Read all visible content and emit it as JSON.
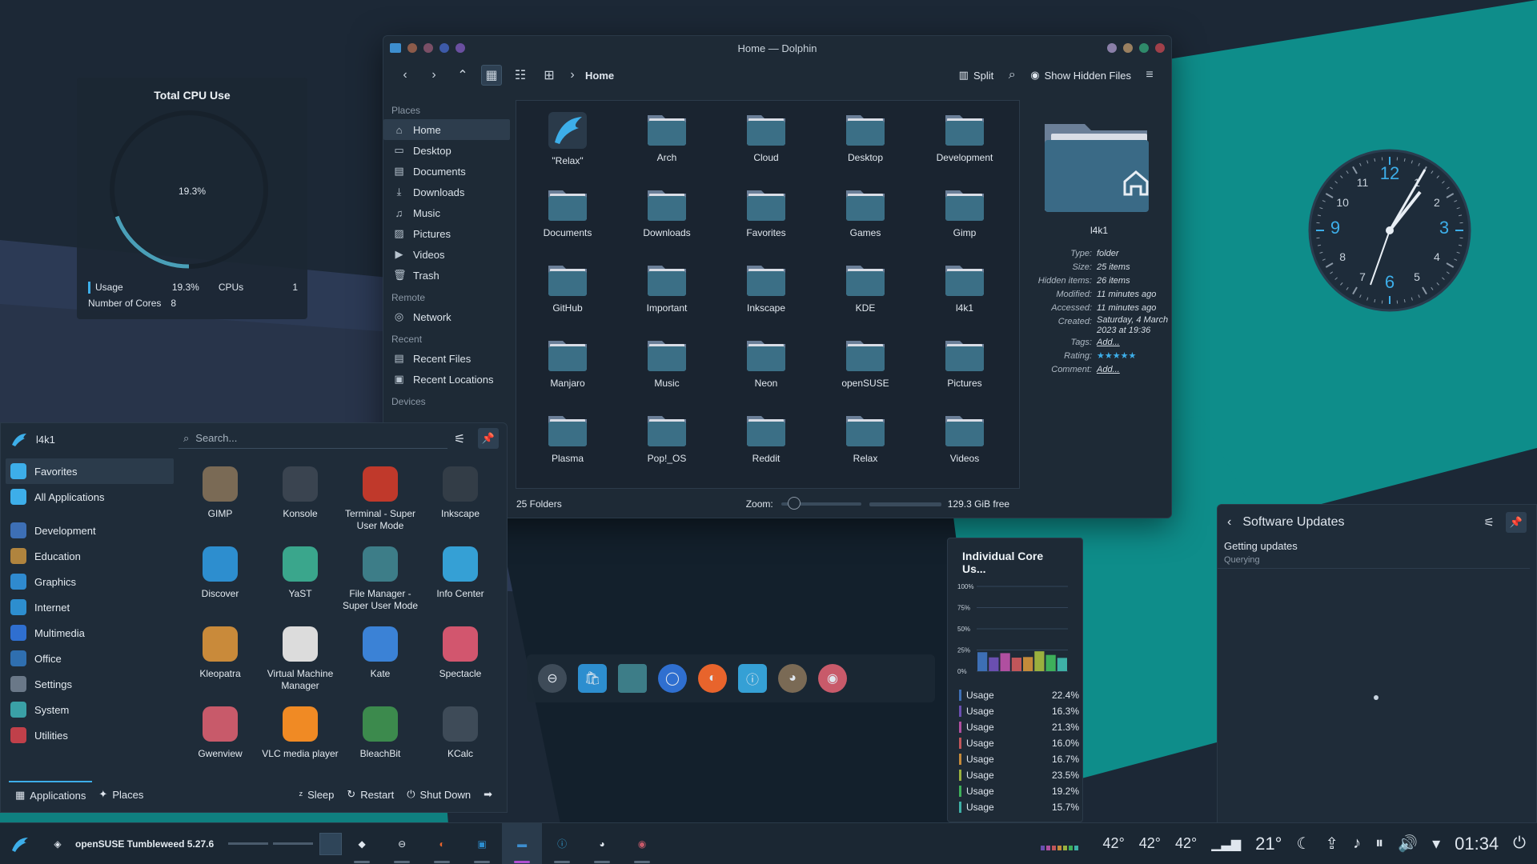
{
  "cpu_widget": {
    "title": "Total CPU Use",
    "percent": "19.3%",
    "usage_label": "Usage",
    "usage_value": "19.3%",
    "cpus_label": "CPUs",
    "cpus_value": "1",
    "cores_label": "Number of Cores",
    "cores_value": "8",
    "usage_fraction": 0.193
  },
  "dolphin": {
    "title": "Home — Dolphin",
    "breadcrumb": "Home",
    "split_label": "Split",
    "show_hidden_label": "Show Hidden Files",
    "places_section": "Places",
    "places": [
      "Home",
      "Desktop",
      "Documents",
      "Downloads",
      "Music",
      "Pictures",
      "Videos",
      "Trash"
    ],
    "remote_section": "Remote",
    "remote": [
      "Network"
    ],
    "recent_section": "Recent",
    "recent": [
      "Recent Files",
      "Recent Locations"
    ],
    "devices_section": "Devices",
    "folders": [
      "\"Relax\"",
      "Arch",
      "Cloud",
      "Desktop",
      "Development",
      "Documents",
      "Downloads",
      "Favorites",
      "Games",
      "Gimp",
      "GitHub",
      "Important",
      "Inkscape",
      "KDE",
      "l4k1",
      "Manjaro",
      "Music",
      "Neon",
      "openSUSE",
      "Pictures",
      "Plasma",
      "Pop!_OS",
      "Reddit",
      "Relax",
      "Videos"
    ],
    "info": {
      "name": "l4k1",
      "type_label": "Type:",
      "type": "folder",
      "size_label": "Size:",
      "size": "25 items",
      "hidden_label": "Hidden items:",
      "hidden": "26 items",
      "modified_label": "Modified:",
      "modified": "11 minutes ago",
      "accessed_label": "Accessed:",
      "accessed": "11 minutes ago",
      "created_label": "Created:",
      "created": "Saturday, 4 March 2023 at 19:36",
      "tags_label": "Tags:",
      "tags": "Add...",
      "rating_label": "Rating:",
      "rating": 5,
      "comment_label": "Comment:",
      "comment": "Add..."
    },
    "status": "25 Folders",
    "zoom_label": "Zoom:",
    "free_space": "129.3 GiB free"
  },
  "clock": {
    "time": "01:34"
  },
  "launcher": {
    "user": "l4k1",
    "search_placeholder": "Search...",
    "categories": [
      "Favorites",
      "All Applications",
      "Development",
      "Education",
      "Graphics",
      "Internet",
      "Multimedia",
      "Office",
      "Settings",
      "System",
      "Utilities"
    ],
    "apps": [
      {
        "name": "GIMP",
        "color": "#7a6a55"
      },
      {
        "name": "Konsole",
        "color": "#3a4450"
      },
      {
        "name": "Terminal - Super User Mode",
        "color": "#c0392b"
      },
      {
        "name": "Inkscape",
        "color": "#333d47"
      },
      {
        "name": "Discover",
        "color": "#2d8ecf"
      },
      {
        "name": "YaST",
        "color": "#3aa68c"
      },
      {
        "name": "File Manager - Super User Mode",
        "color": "#3d7d88"
      },
      {
        "name": "Info Center",
        "color": "#35a0d5"
      },
      {
        "name": "Kleopatra",
        "color": "#c98a3a"
      },
      {
        "name": "Virtual Machine Manager",
        "color": "#dcdcdc"
      },
      {
        "name": "Kate",
        "color": "#3b82d6"
      },
      {
        "name": "Spectacle",
        "color": "#d2566e"
      },
      {
        "name": "Gwenview",
        "color": "#c85a6a"
      },
      {
        "name": "VLC media player",
        "color": "#f08a24"
      },
      {
        "name": "BleachBit",
        "color": "#3c8a4d"
      },
      {
        "name": "KCalc",
        "color": "#3e4b58"
      }
    ],
    "foot_applications": "Applications",
    "foot_places": "Places",
    "sleep": "Sleep",
    "restart": "Restart",
    "shutdown": "Shut Down"
  },
  "core_widget": {
    "title": "Individual Core Us...",
    "y_ticks": [
      "100%",
      "75%",
      "50%",
      "25%",
      "0%"
    ],
    "cores": [
      {
        "label": "Usage",
        "value": "22.4%",
        "frac": 0.224,
        "color": "#3d6fb5"
      },
      {
        "label": "Usage",
        "value": "16.3%",
        "frac": 0.163,
        "color": "#6a4fb0"
      },
      {
        "label": "Usage",
        "value": "21.3%",
        "frac": 0.213,
        "color": "#b04fa0"
      },
      {
        "label": "Usage",
        "value": "16.0%",
        "frac": 0.16,
        "color": "#c0565a"
      },
      {
        "label": "Usage",
        "value": "16.7%",
        "frac": 0.167,
        "color": "#c48a3a"
      },
      {
        "label": "Usage",
        "value": "23.5%",
        "frac": 0.235,
        "color": "#9ab03e"
      },
      {
        "label": "Usage",
        "value": "19.2%",
        "frac": 0.192,
        "color": "#3eb05a"
      },
      {
        "label": "Usage",
        "value": "15.7%",
        "frac": 0.157,
        "color": "#3eb0a6"
      }
    ]
  },
  "updates": {
    "title": "Software Updates",
    "status": "Getting updates",
    "sub": "Querying"
  },
  "taskbar": {
    "distro": "openSUSE Tumbleweed 5.27.6",
    "temps": [
      "42°",
      "42°",
      "42°"
    ],
    "weather": "21°",
    "time": "01:34"
  }
}
